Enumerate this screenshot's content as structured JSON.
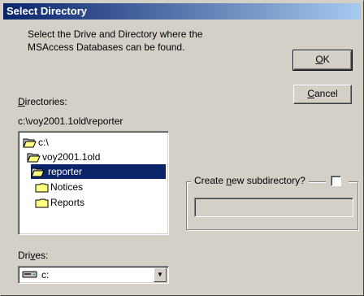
{
  "window": {
    "title": "Select Directory"
  },
  "instructions": {
    "line1": "Select the Drive and Directory where the",
    "line2": "MSAccess Databases can be found."
  },
  "buttons": {
    "ok": {
      "pre": "",
      "accel": "O",
      "post": "K"
    },
    "cancel": {
      "pre": "",
      "accel": "C",
      "post": "ancel"
    }
  },
  "directories": {
    "label_accel": "D",
    "label_rest": "irectories:",
    "current_path": "c:\\voy2001.1old\\reporter",
    "items": [
      {
        "label": "c:\\",
        "icon": "open-folder-icon"
      },
      {
        "label": "voy2001.1old",
        "icon": "open-folder-icon"
      },
      {
        "label": "reporter",
        "icon": "open-folder-icon",
        "selected": true
      },
      {
        "label": "Notices",
        "icon": "folder-icon"
      },
      {
        "label": "Reports",
        "icon": "folder-icon"
      }
    ]
  },
  "subdirectory": {
    "label_pre": "Create ",
    "label_accel": "n",
    "label_post": "ew subdirectory?",
    "checked": false,
    "input_value": ""
  },
  "drives": {
    "label_pre": "Dri",
    "label_accel": "v",
    "label_post": "es:",
    "selected": "c:",
    "icon": "drive-icon"
  },
  "colors": {
    "titlebar": "#0a246a",
    "selection": "#0a246a",
    "face": "#d4d0c8"
  }
}
